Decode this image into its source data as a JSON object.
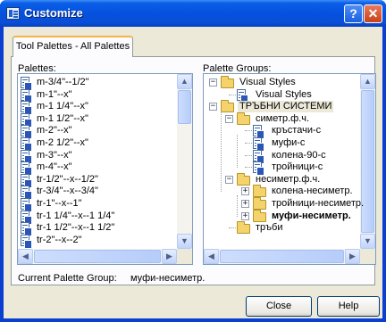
{
  "window": {
    "title": "Customize",
    "help_glyph": "?",
    "close_glyph": "✕"
  },
  "tab": {
    "label": "Tool Palettes - All Palettes"
  },
  "palettes": {
    "label": "Palettes:",
    "items": [
      "m-3/4\"--1/2\"",
      "m-1\"--x\"",
      "m-1 1/4\"--x\"",
      "m-1 1/2\"--x\"",
      "m-2\"--x\"",
      "m-2 1/2\"--x\"",
      "m-3\"--x\"",
      "m-4\"--x\"",
      "tr-1/2\"--x--1/2\"",
      "tr-3/4\"--x--3/4\"",
      "tr-1\"--x--1\"",
      "tr-1 1/4\"--x--1 1/4\"",
      "tr-1 1/2\"--x--1 1/2\"",
      "tr-2\"--x--2\""
    ]
  },
  "palette_groups": {
    "label": "Palette Groups:",
    "tree": [
      {
        "label": "Visual Styles",
        "type": "folder",
        "expander": "−"
      },
      {
        "label": "Visual Styles",
        "type": "doc"
      },
      {
        "label": "ТРЪБНИ СИСТЕМИ",
        "type": "folder",
        "expander": "−"
      },
      {
        "label": "симетр.ф.ч.",
        "type": "folder",
        "expander": "−"
      },
      {
        "label": "кръстачи-с",
        "type": "doc"
      },
      {
        "label": "муфи-с",
        "type": "doc"
      },
      {
        "label": "колена-90-с",
        "type": "doc"
      },
      {
        "label": "тройници-с",
        "type": "doc"
      },
      {
        "label": "несиметр.ф.ч.",
        "type": "folder",
        "expander": "−"
      },
      {
        "label": "колена-несиметр.",
        "type": "folder",
        "expander": "+"
      },
      {
        "label": "тройници-несиметр.",
        "type": "folder",
        "expander": "+"
      },
      {
        "label": "муфи-несиметр.",
        "type": "folder",
        "expander": "+"
      },
      {
        "label": "тръби",
        "type": "folder"
      }
    ]
  },
  "current_group": {
    "label": "Current Palette Group:",
    "value": "муфи-несиметр."
  },
  "buttons": {
    "close": "Close",
    "help": "Help"
  },
  "scroll_glyphs": {
    "up": "▲",
    "down": "▼",
    "left": "◀",
    "right": "▶"
  }
}
